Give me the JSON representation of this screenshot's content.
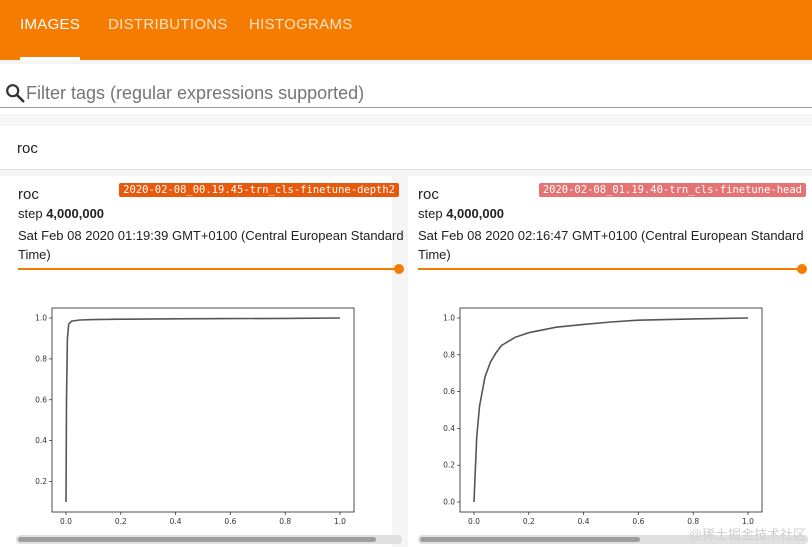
{
  "tabs": [
    {
      "label": "IMAGES",
      "active": true
    },
    {
      "label": "DISTRIBUTIONS",
      "active": false
    },
    {
      "label": "HISTOGRAMS",
      "active": false
    }
  ],
  "filter": {
    "placeholder": "Filter tags (regular expressions supported)",
    "icon": "search-icon"
  },
  "group": {
    "title": "roc"
  },
  "cards": [
    {
      "title": "roc",
      "run": "2020-02-08_00.19.45-trn_cls-finetune-depth2",
      "run_color": "#e8590c",
      "step_label": "step",
      "step_value": "4,000,000",
      "time_line1": "Sat Feb 08 2020 01:19:39 GMT+0100 (Central European Standard",
      "time_line2": "Time)",
      "slider_value": 1.0
    },
    {
      "title": "roc",
      "run": "2020-02-08_01.19.40-trn_cls-finetune-head",
      "run_color": "#e57373",
      "step_label": "step",
      "step_value": "4,000,000",
      "time_line1": "Sat Feb 08 2020 02:16:47 GMT+0100 (Central European Standard",
      "time_line2": "Time)",
      "slider_value": 1.0
    }
  ],
  "chart_data": [
    {
      "type": "line",
      "x": [
        0.0,
        0.002,
        0.005,
        0.01,
        0.02,
        0.05,
        0.1,
        0.2,
        0.4,
        0.6,
        0.8,
        1.0
      ],
      "y": [
        0.1,
        0.6,
        0.9,
        0.97,
        0.985,
        0.99,
        0.992,
        0.994,
        0.996,
        0.997,
        0.998,
        1.0
      ],
      "xlim": [
        0.0,
        1.0
      ],
      "ylim": [
        0.1,
        1.0
      ],
      "xticks": [
        "0.0",
        "0.2",
        "0.4",
        "0.6",
        "0.8",
        "1.0"
      ],
      "yticks": [
        "0.2",
        "0.4",
        "0.6",
        "0.8",
        "1.0"
      ],
      "ytick_values": [
        0.2,
        0.4,
        0.6,
        0.8,
        1.0
      ],
      "xtick_values": [
        0.0,
        0.2,
        0.4,
        0.6,
        0.8,
        1.0
      ],
      "grid": false,
      "color": "#555555"
    },
    {
      "type": "line",
      "x": [
        0.0,
        0.01,
        0.02,
        0.04,
        0.06,
        0.08,
        0.1,
        0.15,
        0.2,
        0.3,
        0.4,
        0.5,
        0.6,
        0.8,
        1.0
      ],
      "y": [
        0.0,
        0.35,
        0.52,
        0.68,
        0.76,
        0.81,
        0.85,
        0.895,
        0.92,
        0.95,
        0.965,
        0.978,
        0.988,
        0.995,
        1.0
      ],
      "xlim": [
        0.0,
        1.0
      ],
      "ylim": [
        0.0,
        1.0
      ],
      "xticks": [
        "0.0",
        "0.2",
        "0.4",
        "0.6",
        "0.8",
        "1.0"
      ],
      "yticks": [
        "0.0",
        "0.2",
        "0.4",
        "0.6",
        "0.8",
        "1.0"
      ],
      "ytick_values": [
        0.0,
        0.2,
        0.4,
        0.6,
        0.8,
        1.0
      ],
      "xtick_values": [
        0.0,
        0.2,
        0.4,
        0.6,
        0.8,
        1.0
      ],
      "grid": false,
      "color": "#555555"
    }
  ],
  "watermark": "@稀土掘金技术社区",
  "colors": {
    "accent": "#f57c00"
  }
}
